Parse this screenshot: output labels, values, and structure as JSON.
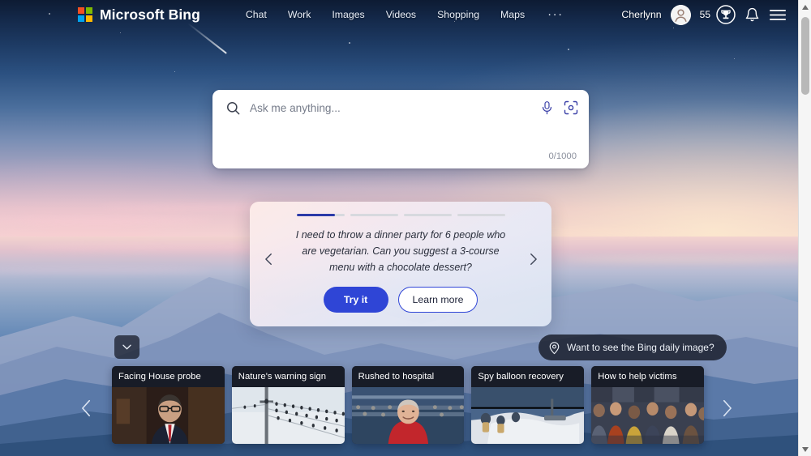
{
  "header": {
    "brand": "Microsoft Bing",
    "logo_icon": "microsoft-logo-icon",
    "logo_colors": [
      "#f25022",
      "#7fba00",
      "#00a4ef",
      "#ffb900"
    ],
    "nav": [
      {
        "label": "Chat",
        "name": "nav-chat"
      },
      {
        "label": "Work",
        "name": "nav-work"
      },
      {
        "label": "Images",
        "name": "nav-images"
      },
      {
        "label": "Videos",
        "name": "nav-videos"
      },
      {
        "label": "Shopping",
        "name": "nav-shopping"
      },
      {
        "label": "Maps",
        "name": "nav-maps"
      }
    ],
    "more_label": "···",
    "user_name": "Cherlynn",
    "avatar_icon": "user-avatar-icon",
    "rewards_count": "55",
    "rewards_icon": "trophy-icon",
    "notifications_icon": "bell-icon",
    "menu_icon": "hamburger-menu-icon"
  },
  "search": {
    "value": "",
    "placeholder": "Ask me anything...",
    "search_icon": "search-icon",
    "mic_icon": "microphone-icon",
    "visual_search_icon": "visual-search-camera-icon",
    "char_count": "0/1000"
  },
  "suggestion": {
    "progress": [
      {
        "fill_percent": 80
      },
      {
        "fill_percent": 0
      },
      {
        "fill_percent": 0
      },
      {
        "fill_percent": 0
      }
    ],
    "prompt": "I need to throw a dinner party for 6 people who are vegetarian. Can you suggest a 3-course menu with a chocolate dessert?",
    "prev_icon": "chevron-left-icon",
    "next_icon": "chevron-right-icon",
    "primary_label": "Try it",
    "secondary_label": "Learn more",
    "primary_color": "#2f45d6"
  },
  "daily_image": {
    "label": "Want to see the Bing daily image?",
    "icon": "location-pin-icon"
  },
  "collapse": {
    "icon": "chevron-down-icon"
  },
  "news": {
    "prev_icon": "chevron-left-icon",
    "next_icon": "chevron-right-icon",
    "cards": [
      {
        "title": "Facing House probe",
        "name": "news-card-facing-house-probe"
      },
      {
        "title": "Nature's warning sign",
        "name": "news-card-natures-warning-sign"
      },
      {
        "title": "Rushed to hospital",
        "name": "news-card-rushed-to-hospital"
      },
      {
        "title": "Spy balloon recovery",
        "name": "news-card-spy-balloon-recovery"
      },
      {
        "title": "How to help victims",
        "name": "news-card-how-to-help-victims"
      }
    ]
  },
  "scrollbar": {
    "up_icon": "scroll-up-arrow-icon",
    "down_icon": "scroll-down-arrow-icon"
  }
}
